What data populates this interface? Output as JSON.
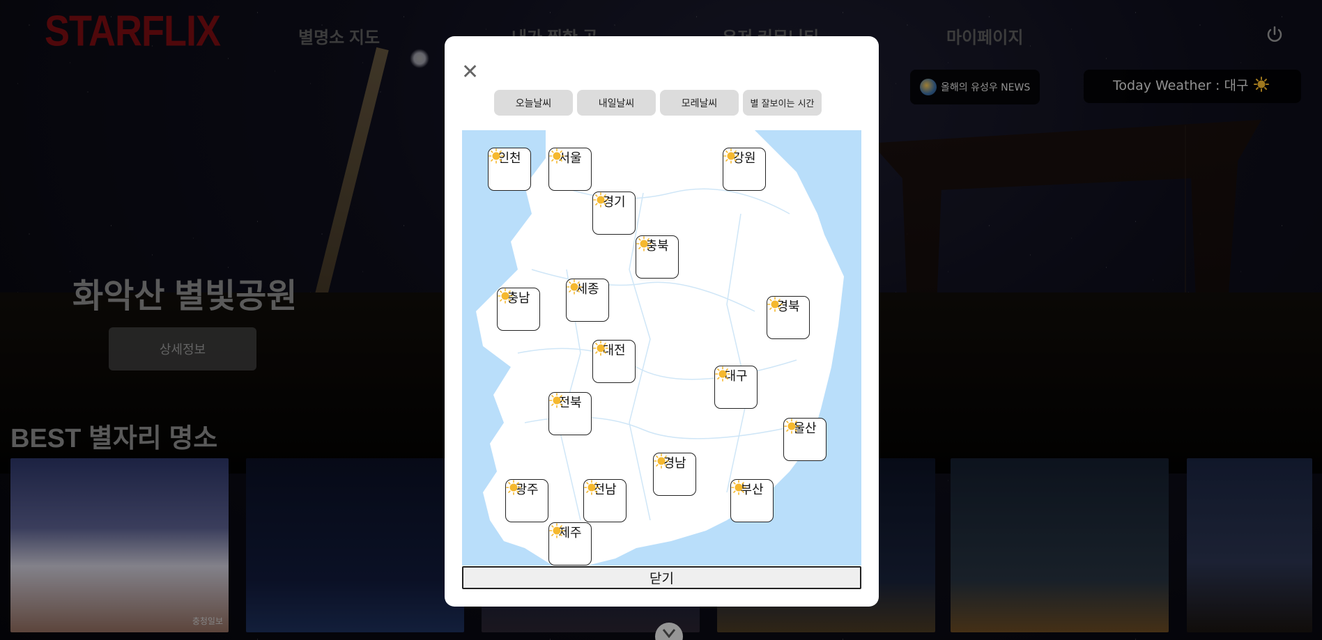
{
  "header": {
    "logo": "STARFLIX",
    "nav": [
      {
        "label": "별명소 지도"
      },
      {
        "label": "내가 찜한 곳"
      },
      {
        "label": "유저 커뮤니티"
      },
      {
        "label": "마이페이지"
      }
    ],
    "power_icon": "power-icon",
    "news_label": "올해의 유성우 NEWS",
    "weather_label": "Today Weather : 대구"
  },
  "hero": {
    "title": "화악산 별빛공원",
    "detail_button": "상세정보"
  },
  "best": {
    "title": "BEST 별자리 명소",
    "cards": [
      {
        "caption": "충청일보"
      },
      {
        "caption": ""
      },
      {
        "caption": ""
      },
      {
        "caption": ""
      },
      {
        "caption": ""
      },
      {
        "caption": ""
      }
    ]
  },
  "modal": {
    "close_icon": "close-icon",
    "tabs": [
      {
        "label": "오늘날씨"
      },
      {
        "label": "내일날씨"
      },
      {
        "label": "모레날씨"
      },
      {
        "label": "별 잘보이는 시간"
      }
    ],
    "regions": [
      {
        "name": "인천",
        "weather": "sunny"
      },
      {
        "name": "서울",
        "weather": "sunny"
      },
      {
        "name": "강원",
        "weather": "sunny"
      },
      {
        "name": "경기",
        "weather": "sunny"
      },
      {
        "name": "충북",
        "weather": "sunny"
      },
      {
        "name": "충남",
        "weather": "sunny"
      },
      {
        "name": "세종",
        "weather": "sunny"
      },
      {
        "name": "경북",
        "weather": "sunny"
      },
      {
        "name": "대전",
        "weather": "sunny"
      },
      {
        "name": "대구",
        "weather": "sunny"
      },
      {
        "name": "전북",
        "weather": "sunny"
      },
      {
        "name": "울산",
        "weather": "sunny"
      },
      {
        "name": "경남",
        "weather": "sunny"
      },
      {
        "name": "광주",
        "weather": "sunny"
      },
      {
        "name": "전남",
        "weather": "sunny"
      },
      {
        "name": "부산",
        "weather": "sunny"
      },
      {
        "name": "제주",
        "weather": "sunny"
      }
    ],
    "close_button": "닫기"
  },
  "colors": {
    "logo": "#7a0d11",
    "sea": "#b9defa",
    "land": "#ffffff",
    "sun": "#f5b82e"
  }
}
